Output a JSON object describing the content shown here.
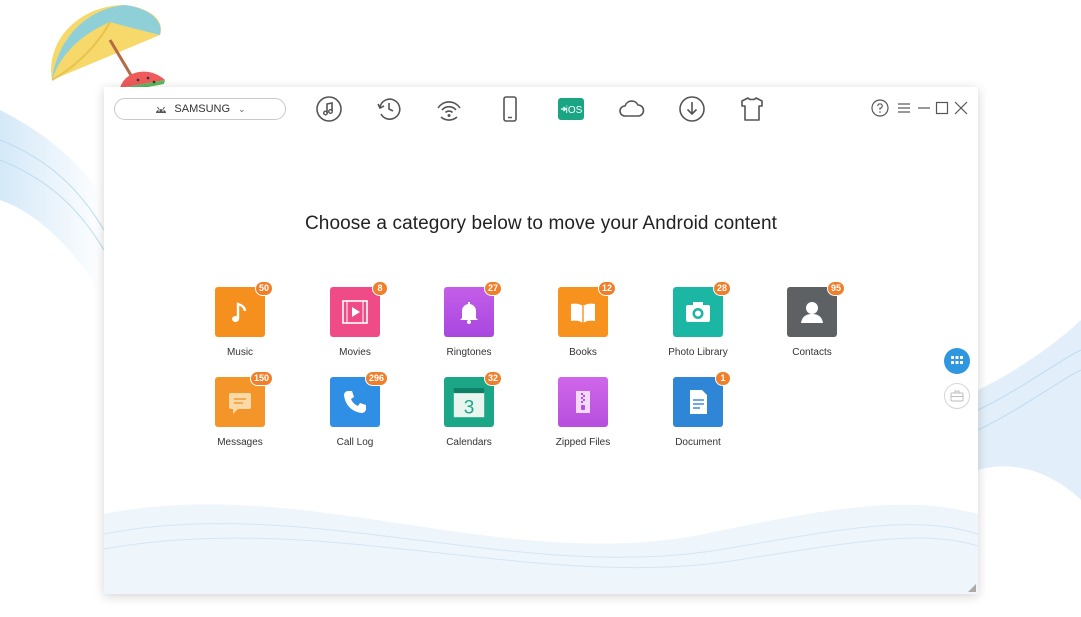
{
  "device": {
    "name": "SAMSUNG"
  },
  "toolbar": {
    "items": [
      {
        "icon": "music-note-icon"
      },
      {
        "icon": "history-icon"
      },
      {
        "icon": "wifi-icon"
      },
      {
        "icon": "phone-icon"
      },
      {
        "icon": "ios-transfer-icon",
        "label": "iOS",
        "active": true
      },
      {
        "icon": "cloud-icon"
      },
      {
        "icon": "download-icon"
      },
      {
        "icon": "tshirt-icon"
      }
    ],
    "accent": "#1aa585"
  },
  "window_controls": [
    "help-icon",
    "menu-icon",
    "minimize-icon",
    "maximize-icon",
    "close-icon"
  ],
  "headline": "Choose a category below to move your Android content",
  "categories": [
    {
      "label": "Music",
      "count": "50",
      "color": "#f58f1d",
      "icon": "music-icon"
    },
    {
      "label": "Movies",
      "count": "8",
      "color": "#ef4b86",
      "icon": "movie-icon"
    },
    {
      "label": "Ringtones",
      "count": "27",
      "color": "#b84fe4",
      "icon": "bell-icon"
    },
    {
      "label": "Books",
      "count": "12",
      "color": "#f7921e",
      "icon": "book-icon"
    },
    {
      "label": "Photo Library",
      "count": "28",
      "color": "#1bb6a4",
      "icon": "camera-icon"
    },
    {
      "label": "Contacts",
      "count": "95",
      "color": "#5e6164",
      "icon": "contact-icon"
    },
    {
      "label": "Messages",
      "count": "150",
      "color": "#f39528",
      "icon": "message-icon"
    },
    {
      "label": "Call Log",
      "count": "296",
      "color": "#2f8fe4",
      "icon": "phone-call-icon"
    },
    {
      "label": "Calendars",
      "count": "32",
      "color": "#1ba787",
      "icon": "calendar-icon",
      "glyph_text": "3"
    },
    {
      "label": "Zipped Files",
      "count": "",
      "color": "#c65ce4",
      "icon": "zip-icon"
    },
    {
      "label": "Document",
      "count": "1",
      "color": "#2f86d6",
      "icon": "document-icon"
    }
  ],
  "side_buttons": [
    {
      "icon": "grid-view-icon",
      "active": true
    },
    {
      "icon": "toolbox-icon",
      "active": false
    }
  ]
}
